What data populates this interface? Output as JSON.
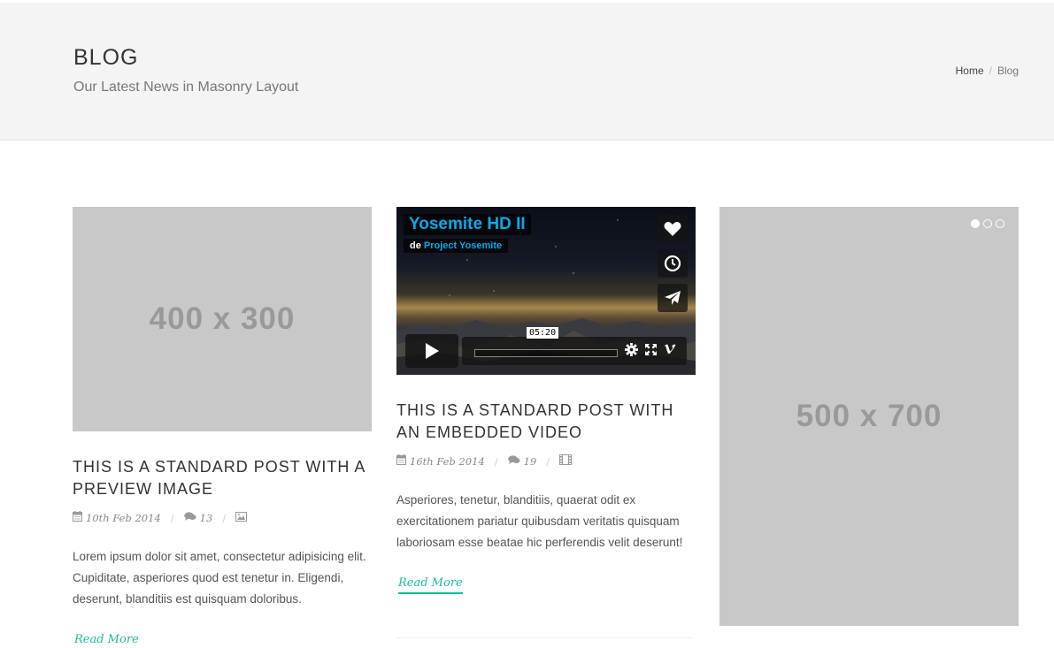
{
  "header": {
    "title": "BLOG",
    "subtitle": "Our Latest News in Masonry Layout",
    "breadcrumb": {
      "home": "Home",
      "separator": "/",
      "current": "Blog"
    }
  },
  "posts": [
    {
      "placeholder_label": "400 x 300",
      "title": "THIS IS A STANDARD POST WITH A PREVIEW IMAGE",
      "date": "10th Feb 2014",
      "comments": "13",
      "excerpt": "Lorem ipsum dolor sit amet, consectetur adipisicing elit. Cupiditate, asperiores quod est tenetur in. Eligendi, deserunt, blanditiis est quisquam doloribus.",
      "read_more": "Read More",
      "format_icon": "image-icon"
    },
    {
      "video": {
        "title": "Yosemite HD II",
        "byline_prefix": "de",
        "byline_author": "Project Yosemite",
        "time": "05:20"
      },
      "title": "THIS IS A STANDARD POST WITH AN EMBEDDED VIDEO",
      "date": "16th Feb 2014",
      "comments": "19",
      "excerpt": "Asperiores, tenetur, blanditiis, quaerat odit ex exercitationem pariatur quibusdam veritatis quisquam laboriosam esse beatae hic perferendis velit deserunt!",
      "read_more": "Read More",
      "format_icon": "film-icon"
    },
    {
      "placeholder_label": "500 x 700",
      "slider_dots": 3,
      "active_dot": 1
    }
  ],
  "colors": {
    "accent": "#1abc9c",
    "placeholder": "#c8c8c8",
    "header_bg": "#f4f4f4",
    "vimeo_blue": "#00adef"
  }
}
